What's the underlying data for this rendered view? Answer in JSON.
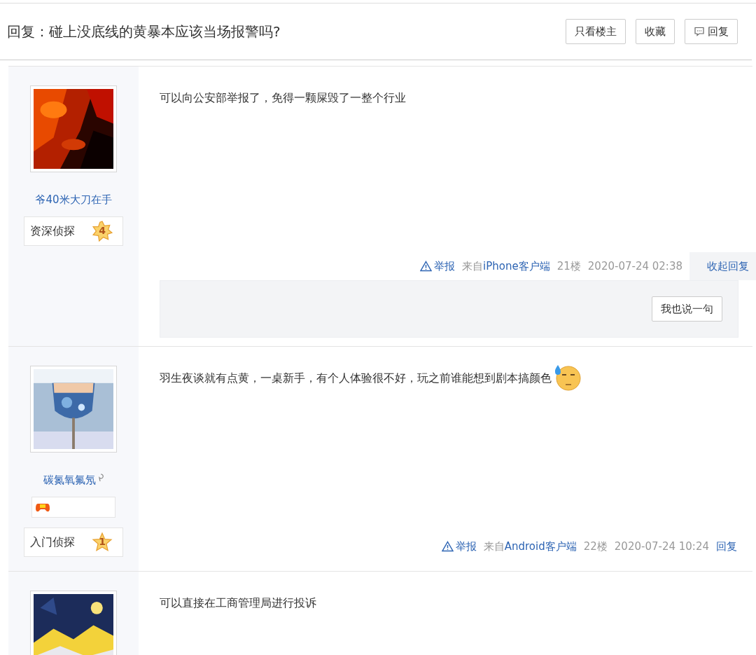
{
  "thread": {
    "title": "回复：碰上没底线的黄暴本应该当场报警吗?",
    "buttons": [
      {
        "label": "只看楼主",
        "kind": "plain"
      },
      {
        "label": "收藏",
        "kind": "plain"
      },
      {
        "label": "回复",
        "kind": "comment"
      }
    ]
  },
  "posts": [
    {
      "author": {
        "name": "爷40米大刀在手",
        "gender_mark": false,
        "badge": false,
        "rank": {
          "label": "资深侦探",
          "level": "4",
          "kind": "sun"
        }
      },
      "content": "可以向公安部举报了，免得一颗屎毁了一整个行业",
      "emoji": false,
      "footer": {
        "report": "举报",
        "source": "来自",
        "client": "iPhone客户端",
        "floor": "21楼",
        "time": "2020-07-24 02:38",
        "reply_label": "收起回复",
        "expanded": true,
        "reply_button": "我也说一句"
      }
    },
    {
      "author": {
        "name": "碳氮氧氟氖",
        "gender_mark": true,
        "badge": true,
        "rank": {
          "label": "入门侦探",
          "level": "1",
          "kind": "star"
        }
      },
      "content": "羽生夜谈就有点黄，一桌新手，有个人体验很不好，玩之前谁能想到剧本搞颜色",
      "emoji": true,
      "footer": {
        "report": "举报",
        "source": "来自",
        "client": "Android客户端",
        "floor": "22楼",
        "time": "2020-07-24 10:24",
        "reply_label": "回复",
        "expanded": false
      }
    },
    {
      "content": "可以直接在工商管理局进行投诉"
    }
  ]
}
